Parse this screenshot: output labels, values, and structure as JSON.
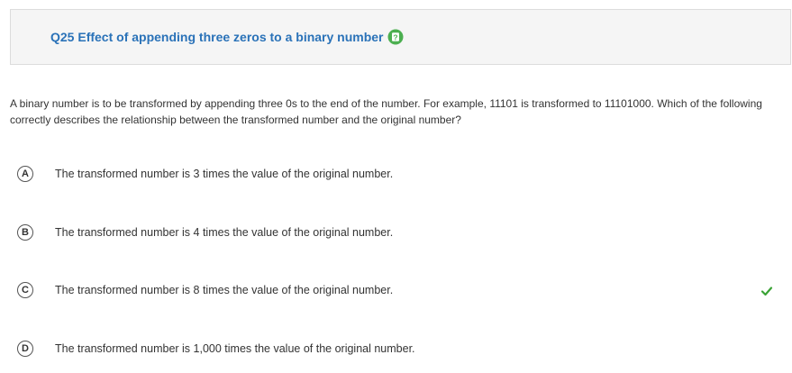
{
  "question": {
    "title": "Q25 Effect of appending three zeros to a binary number",
    "help_icon": "question-mark-icon",
    "text": "A binary number is to be transformed by appending three 0s to the end of the number. For example, 11101 is transformed to 11101000. Which of the following correctly describes the relationship between the transformed number and the original number?"
  },
  "options": [
    {
      "letter": "A",
      "text": "The transformed number is 3 times the value of the original number.",
      "correct": false
    },
    {
      "letter": "B",
      "text": "The transformed number is 4 times the value of the original number.",
      "correct": false
    },
    {
      "letter": "C",
      "text": "The transformed number is 8 times the value of the original number.",
      "correct": true
    },
    {
      "letter": "D",
      "text": "The transformed number is 1,000 times the value of the original number.",
      "correct": false
    }
  ],
  "colors": {
    "title": "#2a72b8",
    "help_badge": "#4caf50",
    "correct_check": "#3aa335"
  }
}
